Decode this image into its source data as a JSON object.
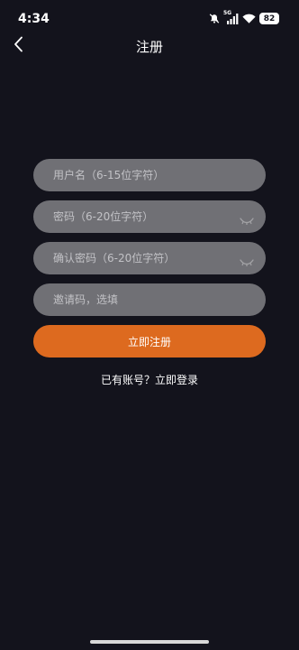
{
  "status_bar": {
    "time": "4:34",
    "network_label": "5G",
    "battery": "82",
    "icons": [
      "mute-icon",
      "signal-icon",
      "wifi-icon",
      "battery-icon"
    ]
  },
  "header": {
    "title": "注册",
    "back_icon": "chevron-left-icon"
  },
  "form": {
    "username_placeholder": "用户名（6-15位字符）",
    "password_placeholder": "密码（6-20位字符）",
    "confirm_password_placeholder": "确认密码（6-20位字符）",
    "invite_code_placeholder": "邀请码，选填",
    "submit_label": "立即注册",
    "login_prompt": "已有账号？立即登录"
  },
  "colors": {
    "background": "#13131c",
    "input_background": "#707075",
    "accent": "#dd6a1f",
    "text": "#ffffff"
  }
}
